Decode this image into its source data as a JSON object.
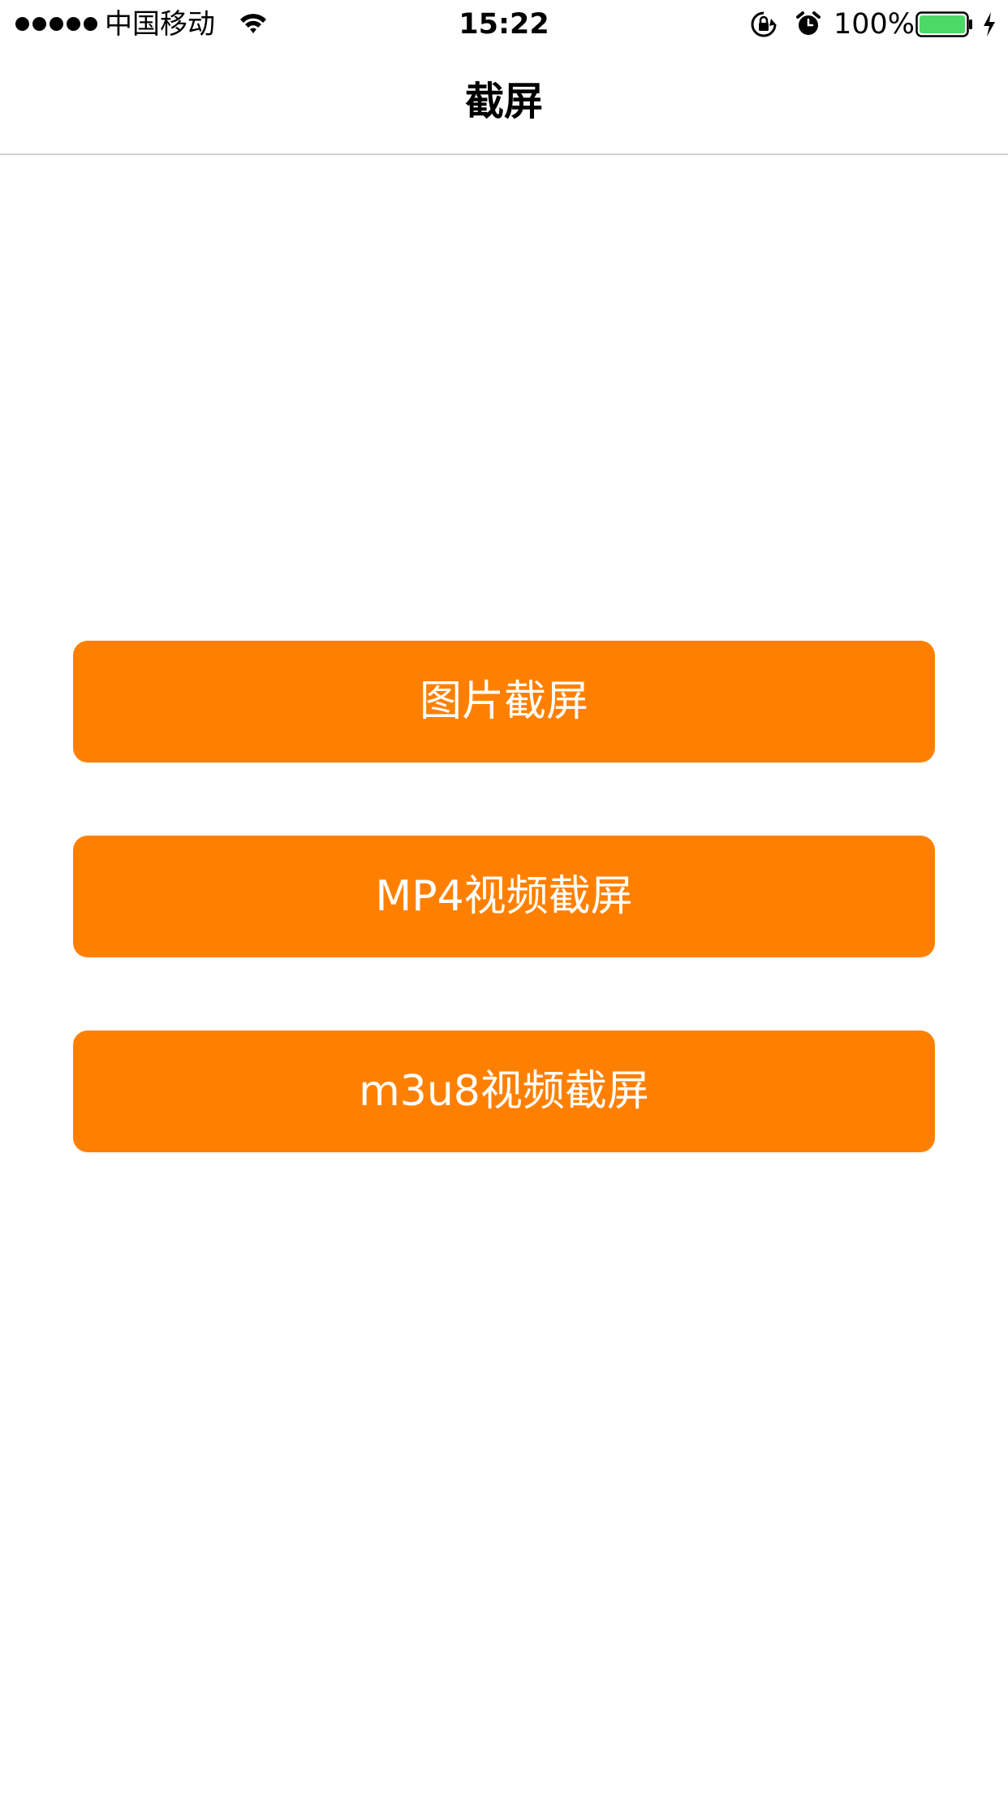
{
  "status_bar": {
    "carrier": "中国移动",
    "time": "15:22",
    "battery_percent": "100%",
    "battery_level": 1.0,
    "battery_color": "#4cd964",
    "icons": [
      "signal-dots-icon",
      "wifi-icon",
      "rotation-lock-icon",
      "alarm-icon",
      "battery-icon",
      "charging-icon"
    ]
  },
  "nav": {
    "title": "截屏"
  },
  "buttons": [
    {
      "label": "图片截屏"
    },
    {
      "label": "MP4视频截屏"
    },
    {
      "label": "m3u8视频截屏"
    }
  ],
  "colors": {
    "accent": "#ff8000",
    "button_text": "#ffffff",
    "background": "#ffffff",
    "separator": "#cfcfd2"
  }
}
